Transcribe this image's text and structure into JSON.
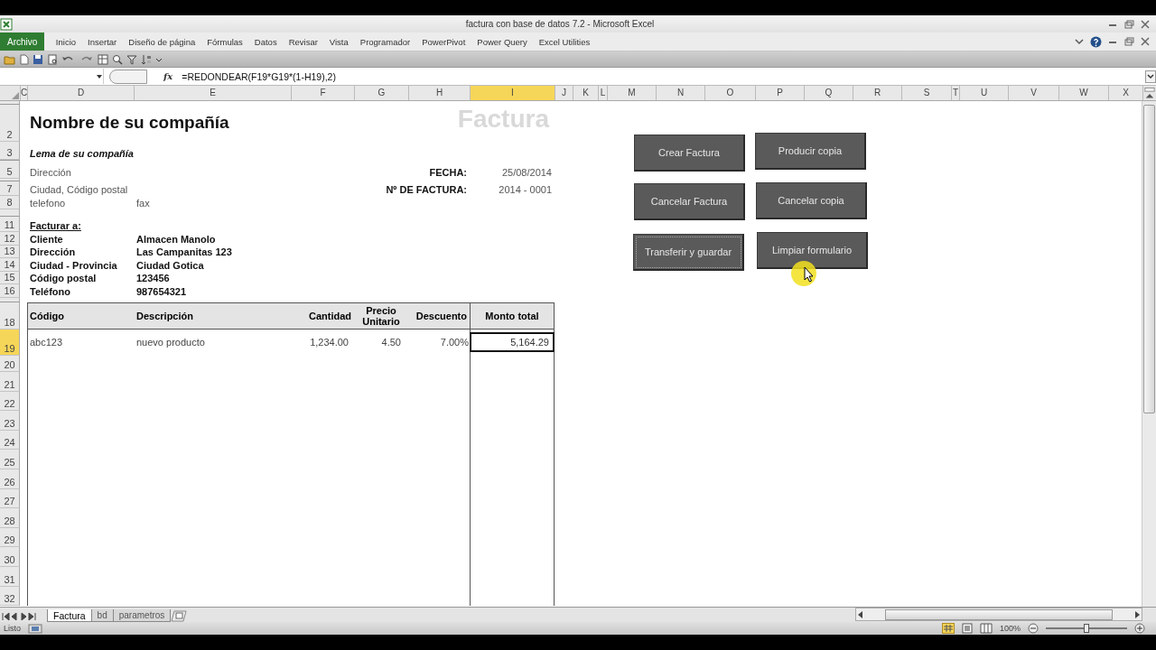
{
  "window": {
    "title": "factura con base de datos 7.2  -  Microsoft Excel"
  },
  "file_tab": "Archivo",
  "ribbon_tabs": [
    "Inicio",
    "Insertar",
    "Diseño de página",
    "Fórmulas",
    "Datos",
    "Revisar",
    "Vista",
    "Programador",
    "PowerPivot",
    "Power Query",
    "Excel Utilities"
  ],
  "formula_bar": {
    "function_label": "fx",
    "formula": "=REDONDEAR(F19*G19*(1-H19),2)"
  },
  "columns": [
    {
      "label": "C",
      "selected": false
    },
    {
      "label": "D",
      "selected": false
    },
    {
      "label": "E",
      "selected": false
    },
    {
      "label": "F",
      "selected": false
    },
    {
      "label": "G",
      "selected": false
    },
    {
      "label": "H",
      "selected": false
    },
    {
      "label": "I",
      "selected": true
    },
    {
      "label": "J",
      "selected": false
    },
    {
      "label": "K",
      "selected": false
    },
    {
      "label": "L",
      "selected": false
    },
    {
      "label": "M",
      "selected": false
    },
    {
      "label": "N",
      "selected": false
    },
    {
      "label": "O",
      "selected": false
    },
    {
      "label": "P",
      "selected": false
    },
    {
      "label": "Q",
      "selected": false
    },
    {
      "label": "R",
      "selected": false
    },
    {
      "label": "S",
      "selected": false
    },
    {
      "label": "T",
      "selected": false
    },
    {
      "label": "U",
      "selected": false
    },
    {
      "label": "V",
      "selected": false
    },
    {
      "label": "W",
      "selected": false
    },
    {
      "label": "X",
      "selected": false
    }
  ],
  "rows": [
    {
      "number": "2",
      "selected": false
    },
    {
      "number": "3",
      "selected": false
    },
    {
      "number": "5",
      "selected": false
    },
    {
      "number": "7",
      "selected": false
    },
    {
      "number": "8",
      "selected": false
    },
    {
      "number": "11",
      "selected": false
    },
    {
      "number": "12",
      "selected": false
    },
    {
      "number": "13",
      "selected": false
    },
    {
      "number": "14",
      "selected": false
    },
    {
      "number": "15",
      "selected": false
    },
    {
      "number": "16",
      "selected": false
    },
    {
      "number": "18",
      "selected": false
    },
    {
      "number": "19",
      "selected": true
    },
    {
      "number": "20",
      "selected": false
    },
    {
      "number": "21",
      "selected": false
    },
    {
      "number": "22",
      "selected": false
    },
    {
      "number": "23",
      "selected": false
    },
    {
      "number": "24",
      "selected": false
    },
    {
      "number": "25",
      "selected": false
    },
    {
      "number": "26",
      "selected": false
    },
    {
      "number": "27",
      "selected": false
    },
    {
      "number": "28",
      "selected": false
    },
    {
      "number": "29",
      "selected": false
    },
    {
      "number": "30",
      "selected": false
    },
    {
      "number": "31",
      "selected": false
    },
    {
      "number": "32",
      "selected": false
    }
  ],
  "invoice": {
    "company": "Nombre de su compañía",
    "title": "Factura",
    "slogan": "Lema de su compañía",
    "address": "Dirección",
    "city": "Ciudad, Código postal",
    "phone": "telefono",
    "fax": "fax",
    "date_label": "FECHA:",
    "date": "25/08/2014",
    "number_label": "Nº DE FACTURA:",
    "number": "2014 - 0001",
    "bill_to": "Facturar a:",
    "client_fields": [
      {
        "label": "Cliente",
        "value": "Almacen Manolo"
      },
      {
        "label": "Dirección",
        "value": "Las Campanitas 123"
      },
      {
        "label": "Ciudad - Provincia",
        "value": "Ciudad Gotica"
      },
      {
        "label": "Código postal",
        "value": "123456"
      },
      {
        "label": "Teléfono",
        "value": "987654321"
      }
    ],
    "table": {
      "columns": [
        "Código",
        "Descripción",
        "Cantidad",
        "Precio Unitario",
        "Descuento",
        "Monto total"
      ],
      "rows": [
        [
          "abc123",
          "nuevo producto",
          "1,234.00",
          "4.50",
          "7.00%",
          "5,164.29"
        ]
      ]
    }
  },
  "buttons": [
    "Crear Factura",
    "Producir copia",
    "Cancelar Factura",
    "Cancelar copia",
    "Transferir y guardar",
    "Limpiar formulario"
  ],
  "sheet_tabs": [
    {
      "label": "Factura",
      "selected": true
    },
    {
      "label": "bd",
      "selected": false
    },
    {
      "label": "parametros",
      "selected": false
    }
  ],
  "status": "Listo",
  "zoom": "100%"
}
